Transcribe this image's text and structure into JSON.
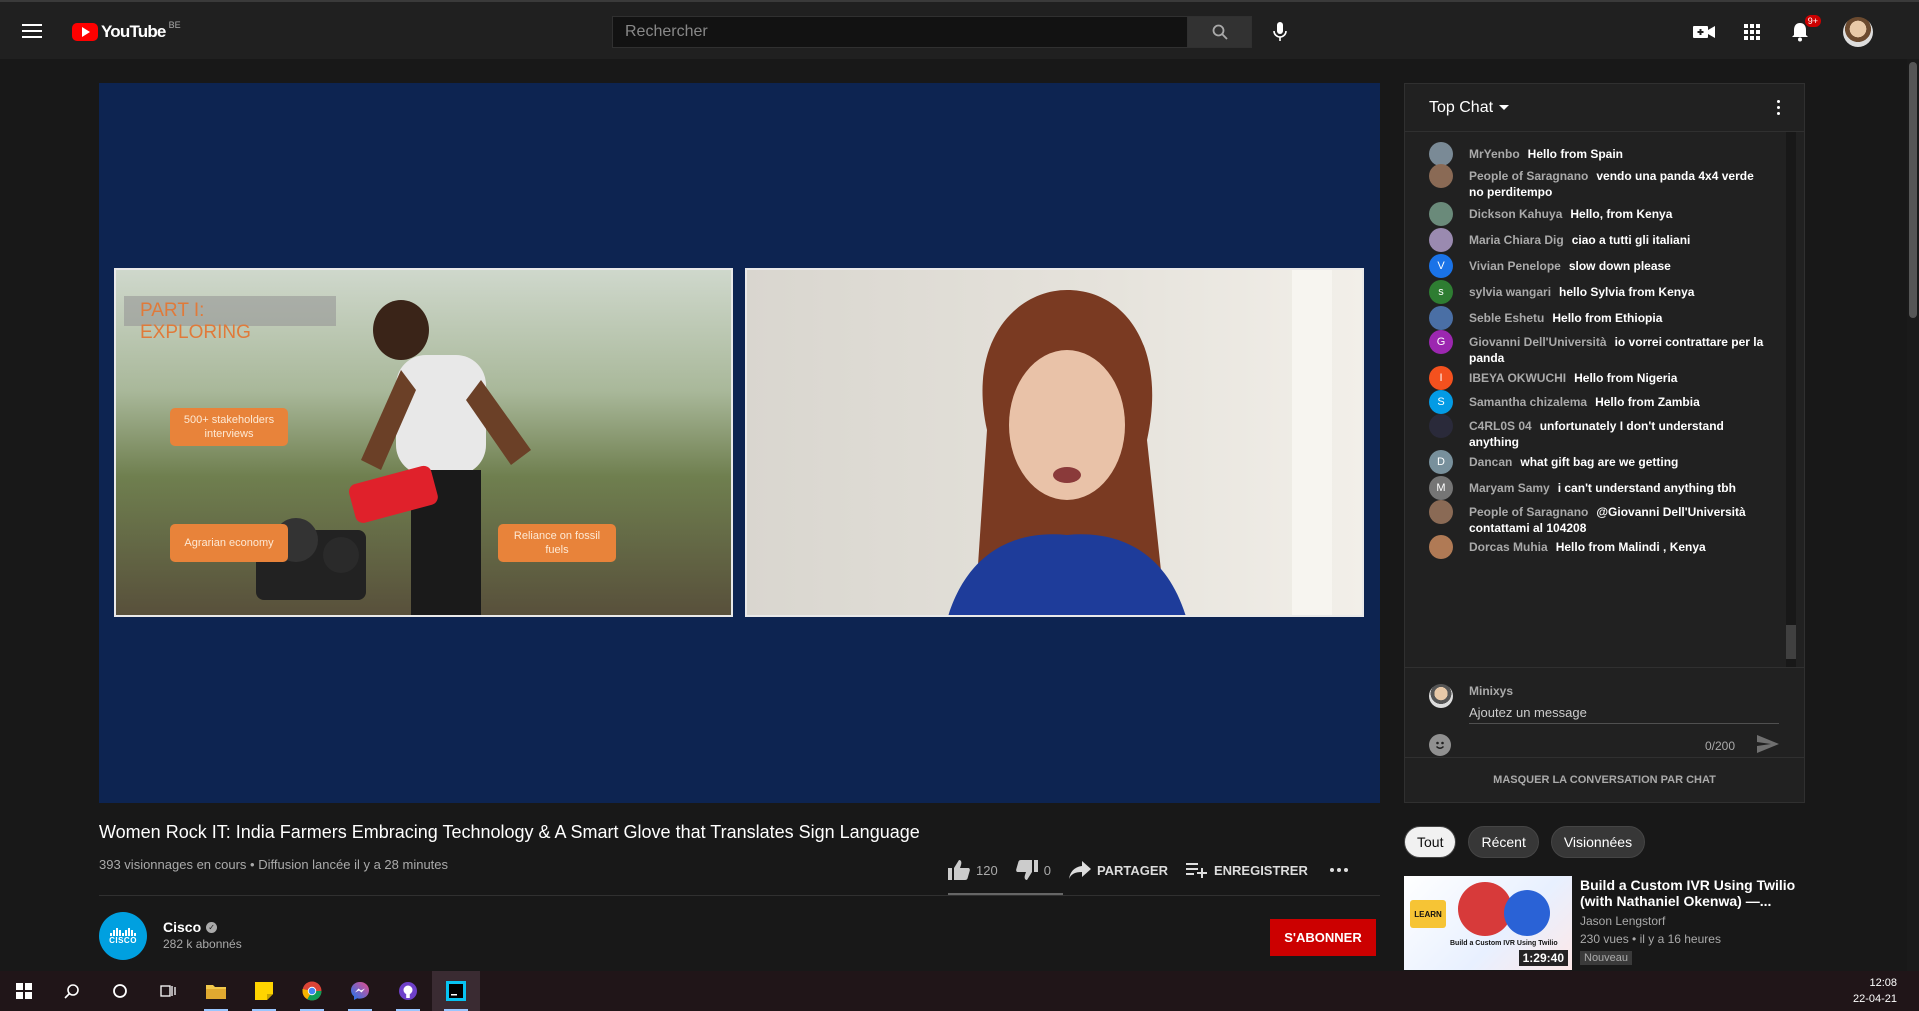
{
  "header": {
    "logo_text": "YouTube",
    "country_code": "BE",
    "search_placeholder": "Rechercher",
    "notification_count": "9+"
  },
  "player": {
    "slide_title": "PART I: EXPLORING",
    "slide_boxes": [
      "500+ stakeholders interviews",
      "Agrarian economy",
      "Reliance on fossil fuels"
    ]
  },
  "video": {
    "title": "Women Rock IT: India Farmers Embracing Technology & A Smart Glove that Translates Sign Language",
    "meta": "393 visionnages en cours • Diffusion lancée il y a 28 minutes",
    "likes": "120",
    "dislikes": "0",
    "share_label": "PARTAGER",
    "save_label": "ENREGISTRER"
  },
  "channel": {
    "name": "Cisco",
    "logo_text": "CISCO",
    "subscribers": "282 k abonnés",
    "subscribe_label": "S'ABONNER"
  },
  "chat": {
    "header": "Top Chat",
    "messages": [
      {
        "author": "MrYenbo",
        "text": "Hello from Spain",
        "avatar_letter": "",
        "avatar_color": "#7a8a96"
      },
      {
        "author": "People of Saragnano",
        "text": "vendo una panda 4x4 verde no perditempo",
        "avatar_letter": "",
        "avatar_color": "#8a6a55"
      },
      {
        "author": "Dickson Kahuya",
        "text": "Hello, from Kenya",
        "avatar_letter": "",
        "avatar_color": "#6a8a7a"
      },
      {
        "author": "Maria Chiara Dig",
        "text": "ciao a tutti gli italiani",
        "avatar_letter": "",
        "avatar_color": "#9a8ab0"
      },
      {
        "author": "Vivian Penelope",
        "text": "slow down please",
        "avatar_letter": "V",
        "avatar_color": "#1a73e8"
      },
      {
        "author": "sylvia wangari",
        "text": "hello Sylvia from Kenya",
        "avatar_letter": "s",
        "avatar_color": "#2e7d32"
      },
      {
        "author": "Seble Eshetu",
        "text": "Hello from Ethiopia",
        "avatar_letter": "",
        "avatar_color": "#4a6fa5"
      },
      {
        "author": "Giovanni Dell'Università",
        "text": "io vorrei contrattare per la panda",
        "avatar_letter": "G",
        "avatar_color": "#9c27b0"
      },
      {
        "author": "IBEYA OKWUCHI",
        "text": "Hello from Nigeria",
        "avatar_letter": "I",
        "avatar_color": "#f4511e"
      },
      {
        "author": "Samantha chizalema",
        "text": "Hello from Zambia",
        "avatar_letter": "S",
        "avatar_color": "#039be5"
      },
      {
        "author": "C4RL0S 04",
        "text": "unfortunately I don't understand anything",
        "avatar_letter": "",
        "avatar_color": "#2a2a3a"
      },
      {
        "author": "Dancan",
        "text": "what gift bag are we getting",
        "avatar_letter": "D",
        "avatar_color": "#78909c"
      },
      {
        "author": "Maryam Samy",
        "text": "i can't understand anything tbh",
        "avatar_letter": "M",
        "avatar_color": "#757575"
      },
      {
        "author": "People of Saragnano",
        "text": "@Giovanni Dell'Università contattami al 104208",
        "avatar_letter": "",
        "avatar_color": "#8a6a55"
      },
      {
        "author": "Dorcas Muhia",
        "text": "Hello from Malindi , Kenya",
        "avatar_letter": "",
        "avatar_color": "#b07a55"
      }
    ],
    "current_user": "Minixys",
    "input_placeholder": "Ajoutez un message",
    "char_counter": "0/200",
    "hide_label": "MASQUER LA CONVERSATION PAR CHAT"
  },
  "filters": {
    "chips": [
      "Tout",
      "Récent",
      "Visionnées"
    ]
  },
  "recommendation": {
    "title": "Build a Custom IVR Using Twilio (with Nathaniel Okenwa) —...",
    "author": "Jason Lengstorf",
    "stats": "230 vues • il y a 16 heures",
    "badge": "Nouveau",
    "duration": "1:29:40",
    "thumb_badge": "LEARN",
    "thumb_caption": "Build a Custom IVR Using Twilio"
  },
  "taskbar": {
    "time": "12:08",
    "date": "22-04-21"
  },
  "colors": {
    "brand_red": "#ff0000",
    "subscribe_red": "#cc0000",
    "player_bg": "#0d2451",
    "slide_orange": "#e8833a"
  }
}
